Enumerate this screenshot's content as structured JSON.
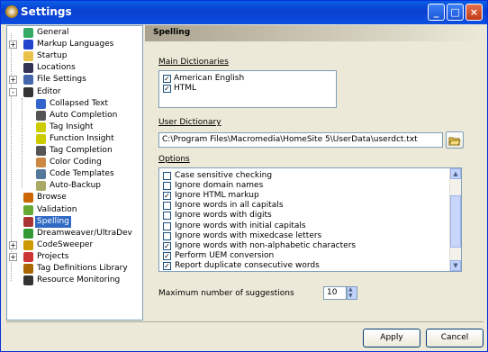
{
  "window": {
    "title": "Settings"
  },
  "tree": [
    {
      "label": "General",
      "icon": "general-icon",
      "indent": 1,
      "expander": ""
    },
    {
      "label": "Markup Languages",
      "icon": "markup-icon",
      "indent": 1,
      "expander": "+"
    },
    {
      "label": "Startup",
      "icon": "folder-open-icon",
      "indent": 1,
      "expander": ""
    },
    {
      "label": "Locations",
      "icon": "locations-icon",
      "indent": 1,
      "expander": ""
    },
    {
      "label": "File Settings",
      "icon": "file-icon",
      "indent": 1,
      "expander": "+"
    },
    {
      "label": "Editor",
      "icon": "editor-icon",
      "indent": 1,
      "expander": "-"
    },
    {
      "label": "Collapsed Text",
      "icon": "collapsed-text-icon",
      "indent": 2,
      "expander": ""
    },
    {
      "label": "Auto Completion",
      "icon": "auto-completion-icon",
      "indent": 2,
      "expander": ""
    },
    {
      "label": "Tag Insight",
      "icon": "tag-insight-icon",
      "indent": 2,
      "expander": ""
    },
    {
      "label": "Function Insight",
      "icon": "function-insight-icon",
      "indent": 2,
      "expander": ""
    },
    {
      "label": "Tag Completion",
      "icon": "tag-completion-icon",
      "indent": 2,
      "expander": ""
    },
    {
      "label": "Color Coding",
      "icon": "color-coding-icon",
      "indent": 2,
      "expander": ""
    },
    {
      "label": "Code Templates",
      "icon": "code-templates-icon",
      "indent": 2,
      "expander": ""
    },
    {
      "label": "Auto-Backup",
      "icon": "auto-backup-icon",
      "indent": 2,
      "expander": ""
    },
    {
      "label": "Browse",
      "icon": "browse-icon",
      "indent": 1,
      "expander": ""
    },
    {
      "label": "Validation",
      "icon": "validation-icon",
      "indent": 1,
      "expander": ""
    },
    {
      "label": "Spelling",
      "icon": "spelling-icon",
      "indent": 1,
      "expander": "",
      "selected": true
    },
    {
      "label": "Dreamweaver/UltraDev",
      "icon": "dreamweaver-icon",
      "indent": 1,
      "expander": ""
    },
    {
      "label": "CodeSweeper",
      "icon": "codesweeper-icon",
      "indent": 1,
      "expander": "+"
    },
    {
      "label": "Projects",
      "icon": "projects-icon",
      "indent": 1,
      "expander": "+"
    },
    {
      "label": "Tag Definitions Library",
      "icon": "tag-library-icon",
      "indent": 1,
      "expander": ""
    },
    {
      "label": "Resource Monitoring",
      "icon": "resource-monitoring-icon",
      "indent": 1,
      "expander": ""
    }
  ],
  "panel": {
    "header": "Spelling",
    "main_dict_label": "Main Dictionaries",
    "main_dicts": [
      {
        "label": "American English",
        "checked": true
      },
      {
        "label": "HTML",
        "checked": true
      }
    ],
    "user_dict_label": "User Dictionary",
    "user_dict_value": "C:\\Program Files\\Macromedia\\HomeSite 5\\UserData\\userdct.txt",
    "options_label": "Options",
    "options": [
      {
        "label": "Case sensitive checking",
        "checked": false
      },
      {
        "label": "Ignore domain names",
        "checked": false
      },
      {
        "label": "Ignore HTML markup",
        "checked": true
      },
      {
        "label": "Ignore words in all capitals",
        "checked": false
      },
      {
        "label": "Ignore words with digits",
        "checked": false
      },
      {
        "label": "Ignore words with initial capitals",
        "checked": false
      },
      {
        "label": "Ignore words with mixedcase letters",
        "checked": false
      },
      {
        "label": "Ignore words with non-alphabetic characters",
        "checked": true
      },
      {
        "label": "Perform UEM conversion",
        "checked": true
      },
      {
        "label": "Report duplicate consecutive words",
        "checked": true
      }
    ],
    "max_suggestions_label": "Maximum number of suggestions",
    "max_suggestions_value": "10"
  },
  "buttons": {
    "apply": "Apply",
    "cancel": "Cancel"
  },
  "colors": {
    "title_bar": "#0a3fd0",
    "selection": "#316ac5",
    "dialog_bg": "#ece9d8"
  }
}
